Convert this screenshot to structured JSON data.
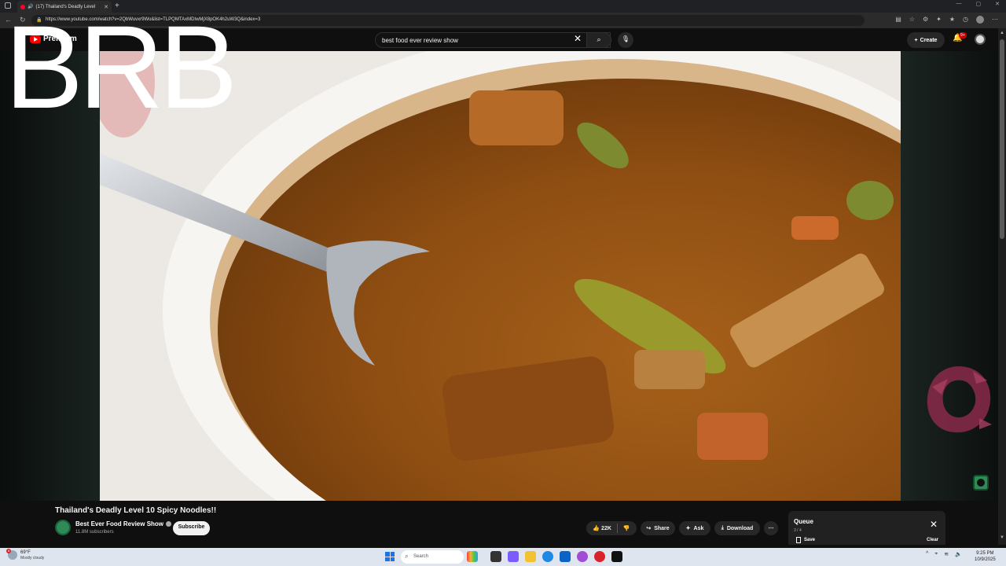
{
  "browser": {
    "tab_title": "(17) Thailand's Deadly Level",
    "url": "https://www.youtube.com/watch?v=2QbWuvxr9Wo&list=TLPQMTAxMDIwMjX8pOK4h2uW3Q&index=3"
  },
  "youtube": {
    "logo_text": "Premium",
    "search_query": "best food ever review show",
    "create_label": "Create",
    "notification_count": "9+"
  },
  "overlay": {
    "brb_text": "BRB"
  },
  "video": {
    "title": "Thailand's Deadly Level 10 Spicy Noodles!!",
    "channel_name": "Best Ever Food Review Show",
    "subscribers": "11.8M subscribers",
    "subscribe_label": "Subscribe",
    "likes": "22K",
    "share_label": "Share",
    "ask_label": "Ask",
    "download_label": "Download"
  },
  "queue": {
    "title": "Queue",
    "position": "3 / 4",
    "save_label": "Save",
    "clear_label": "Clear"
  },
  "taskbar": {
    "weather_temp": "69°F",
    "weather_condition": "Mostly cloudy",
    "weather_alert_count": "4",
    "search_placeholder": "Search",
    "time": "9:25 PM",
    "date": "10/9/2025"
  },
  "colors": {
    "youtube_red": "#ff0000",
    "background": "#0f0f0f",
    "channel_green": "#2e8b57"
  }
}
